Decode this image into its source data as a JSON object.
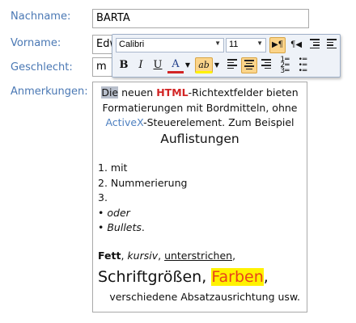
{
  "form": {
    "lastname_label": "Nachname:",
    "lastname_value": "BARTA",
    "firstname_label": "Vorname:",
    "firstname_value": "Edw",
    "gender_label": "Geschlecht:",
    "gender_value": "m",
    "notes_label": "Anmerkungen:"
  },
  "toolbar": {
    "font_name": "Calibri",
    "font_size": "11",
    "bold": "B",
    "italic": "I",
    "underline": "U",
    "font_color": "A",
    "highlight": "ab",
    "ltr_icon": "▶¶",
    "rtl_icon": "¶◀"
  },
  "notes": {
    "intro_word": "Die",
    "intro_1": " neuen ",
    "intro_html": "HTML",
    "intro_2": "-Richtextfelder bieten",
    "intro_line2": "Formatierungen mit Bordmitteln, ohne",
    "intro_activex": "ActiveX",
    "intro_line3": "-Steuerelement. Zum Beispiel",
    "heading": "Auflistungen",
    "list": [
      "1. mit",
      "2. Nummerierung",
      "3."
    ],
    "bullet1": "oder",
    "bullet2": "Bullets",
    "bullet2_tail": ".",
    "fmt_bold": "Fett",
    "fmt_sep1": ", ",
    "fmt_italic": "kursiv",
    "fmt_sep2": ", ",
    "fmt_underline": "unterstrichen",
    "fmt_end": ",",
    "big_text": "Schriftgrößen",
    "big_sep": ", ",
    "colors_text": "Farben",
    "big_end": ",",
    "last_line": "verschiedene Absatzausrichtung usw."
  },
  "colors": {
    "label": "#4a78b4",
    "html_red": "#d22424",
    "activex_blue": "#4c7fc0",
    "highlight_yellow": "#fff200",
    "active_button": "#fbd48a"
  }
}
